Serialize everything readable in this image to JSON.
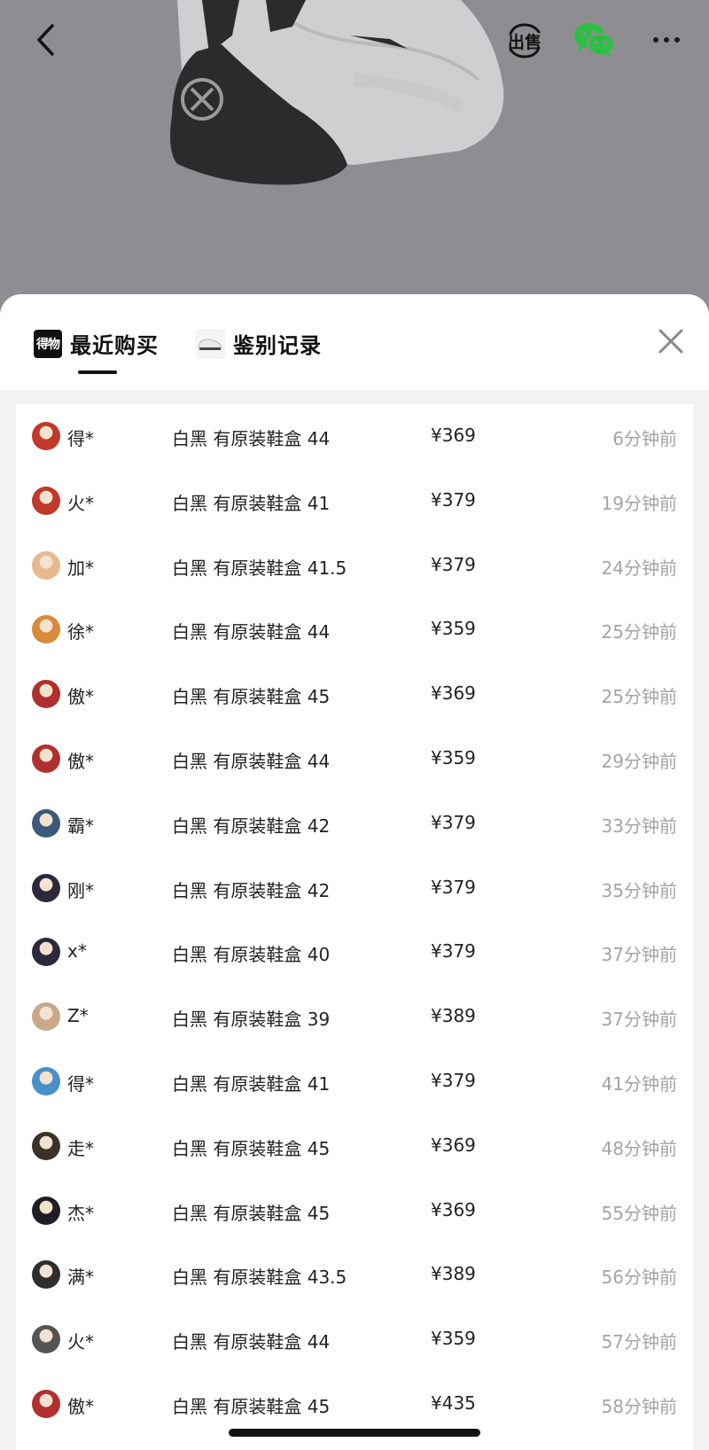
{
  "colors": {
    "backdrop": "#8e8e92",
    "sheet_bg": "#f2f2f4",
    "card_bg": "#ffffff",
    "text_primary": "#222222",
    "text_muted": "#a3a3a8",
    "wechat_green": "#2fbe45"
  },
  "topbar": {
    "back_icon": "chevron-left-icon",
    "sell_label": "出售",
    "share_icon": "wechat-icon",
    "more_icon": "more-dots-icon"
  },
  "sheet": {
    "tabs": [
      {
        "label": "最近购买",
        "icon_text": "得物",
        "active": true
      },
      {
        "label": "鉴别记录",
        "icon": "shoe-thumbnail-icon",
        "active": false
      }
    ],
    "close_icon": "close-icon"
  },
  "purchases": [
    {
      "user": "得*",
      "sku": "白黑 有原装鞋盒 44",
      "price": "¥369",
      "time": "6分钟前",
      "avatar": "#c0392b"
    },
    {
      "user": "火*",
      "sku": "白黑 有原装鞋盒 41",
      "price": "¥379",
      "time": "19分钟前",
      "avatar": "#c0392b"
    },
    {
      "user": "加*",
      "sku": "白黑 有原装鞋盒 41.5",
      "price": "¥379",
      "time": "24分钟前",
      "avatar": "#e8b88f"
    },
    {
      "user": "徐*",
      "sku": "白黑 有原装鞋盒 44",
      "price": "¥359",
      "time": "25分钟前",
      "avatar": "#d98a3a"
    },
    {
      "user": "傲*",
      "sku": "白黑 有原装鞋盒 45",
      "price": "¥369",
      "time": "25分钟前",
      "avatar": "#b03030"
    },
    {
      "user": "傲*",
      "sku": "白黑 有原装鞋盒 44",
      "price": "¥359",
      "time": "29分钟前",
      "avatar": "#b03030"
    },
    {
      "user": "霸*",
      "sku": "白黑 有原装鞋盒 42",
      "price": "¥379",
      "time": "33分钟前",
      "avatar": "#3b5a7a"
    },
    {
      "user": "刚*",
      "sku": "白黑 有原装鞋盒 42",
      "price": "¥379",
      "time": "35分钟前",
      "avatar": "#2a2a3a"
    },
    {
      "user": "x*",
      "sku": "白黑 有原装鞋盒 40",
      "price": "¥379",
      "time": "37分钟前",
      "avatar": "#2a2a3a"
    },
    {
      "user": "Z*",
      "sku": "白黑 有原装鞋盒 39",
      "price": "¥389",
      "time": "37分钟前",
      "avatar": "#c9a98a"
    },
    {
      "user": "得*",
      "sku": "白黑 有原装鞋盒 41",
      "price": "¥379",
      "time": "41分钟前",
      "avatar": "#4a90c8"
    },
    {
      "user": "走*",
      "sku": "白黑 有原装鞋盒 45",
      "price": "¥369",
      "time": "48分钟前",
      "avatar": "#3a3228"
    },
    {
      "user": "杰*",
      "sku": "白黑 有原装鞋盒 45",
      "price": "¥369",
      "time": "55分钟前",
      "avatar": "#1e1e24"
    },
    {
      "user": "满*",
      "sku": "白黑 有原装鞋盒 43.5",
      "price": "¥389",
      "time": "56分钟前",
      "avatar": "#2e2e2e"
    },
    {
      "user": "火*",
      "sku": "白黑 有原装鞋盒 44",
      "price": "¥359",
      "time": "57分钟前",
      "avatar": "#555555"
    },
    {
      "user": "傲*",
      "sku": "白黑 有原装鞋盒 45",
      "price": "¥435",
      "time": "58分钟前",
      "avatar": "#b03030"
    }
  ]
}
